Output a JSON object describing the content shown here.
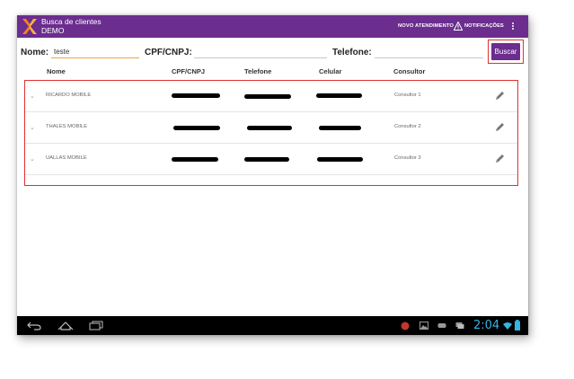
{
  "appbar": {
    "title": "Busca de clientes",
    "subtitle": "DEMO",
    "action_new": "NOVO ATENDIMENTO",
    "action_notifications": "NOTIFICAÇÕES",
    "icons": [
      "logo-icon",
      "warning-icon",
      "overflow-menu-icon"
    ]
  },
  "search": {
    "name_label": "Nome:",
    "name_value": "teste",
    "cpf_label": "CPF/CNPJ:",
    "cpf_value": "",
    "phone_label": "Telefone:",
    "phone_value": "",
    "button_label": "Buscar"
  },
  "columns": [
    "Nome",
    "CPF/CNPJ",
    "Telefone",
    "Celular",
    "Consultor"
  ],
  "rows": [
    {
      "name": "RICARDO MOBILE",
      "cpf": "[redacted]",
      "phone": "[redacted]",
      "mobile": "[redacted]",
      "consultant": "Consultor 1"
    },
    {
      "name": "THALES MOBILE",
      "cpf": "[redacted]",
      "phone": "[redacted]",
      "mobile": "[redacted]",
      "consultant": "Consultor 2"
    },
    {
      "name": "UALLAS MOBILE",
      "cpf": "[redacted]",
      "phone": "[redacted]",
      "mobile": "[redacted]",
      "consultant": "Consultor 3"
    }
  ],
  "systembar": {
    "clock": "2:04",
    "icons": [
      "back-icon",
      "home-icon",
      "recents-icon",
      "notification-icons",
      "wifi-icon",
      "battery-icon"
    ]
  },
  "colors": {
    "brand_purple": "#6b2d8e",
    "highlight_red": "#e03030",
    "input_focus_orange": "#f0a04a",
    "clock_blue": "#33b5e5"
  }
}
